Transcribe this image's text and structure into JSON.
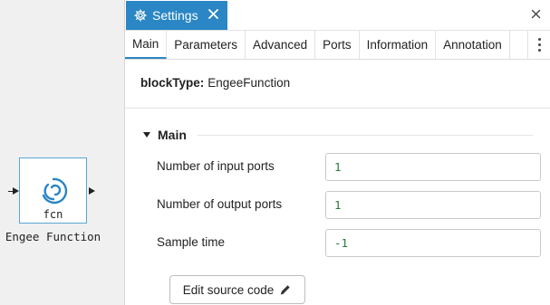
{
  "canvas": {
    "block": {
      "icon": "engee-function-logo-icon",
      "inner_label": "fcn",
      "name": "Engee Function"
    }
  },
  "panel": {
    "title": "Settings",
    "title_icon": "gear-icon",
    "tabs": [
      {
        "label": "Main",
        "active": true
      },
      {
        "label": "Parameters",
        "active": false
      },
      {
        "label": "Advanced",
        "active": false
      },
      {
        "label": "Ports",
        "active": false
      },
      {
        "label": "Information",
        "active": false
      },
      {
        "label": "Annotation",
        "active": false
      }
    ],
    "block_type": {
      "key": "blockType:",
      "value": "EngeeFunction"
    },
    "section": {
      "title": "Main",
      "fields": [
        {
          "label": "Number of input ports",
          "value": "1"
        },
        {
          "label": "Number of output ports",
          "value": "1"
        },
        {
          "label": "Sample time",
          "value": "-1"
        }
      ],
      "edit_button": "Edit source code"
    }
  },
  "colors": {
    "accent": "#2a86c4",
    "value_text": "#2a7a3a",
    "block_border": "#5aa6d6"
  }
}
